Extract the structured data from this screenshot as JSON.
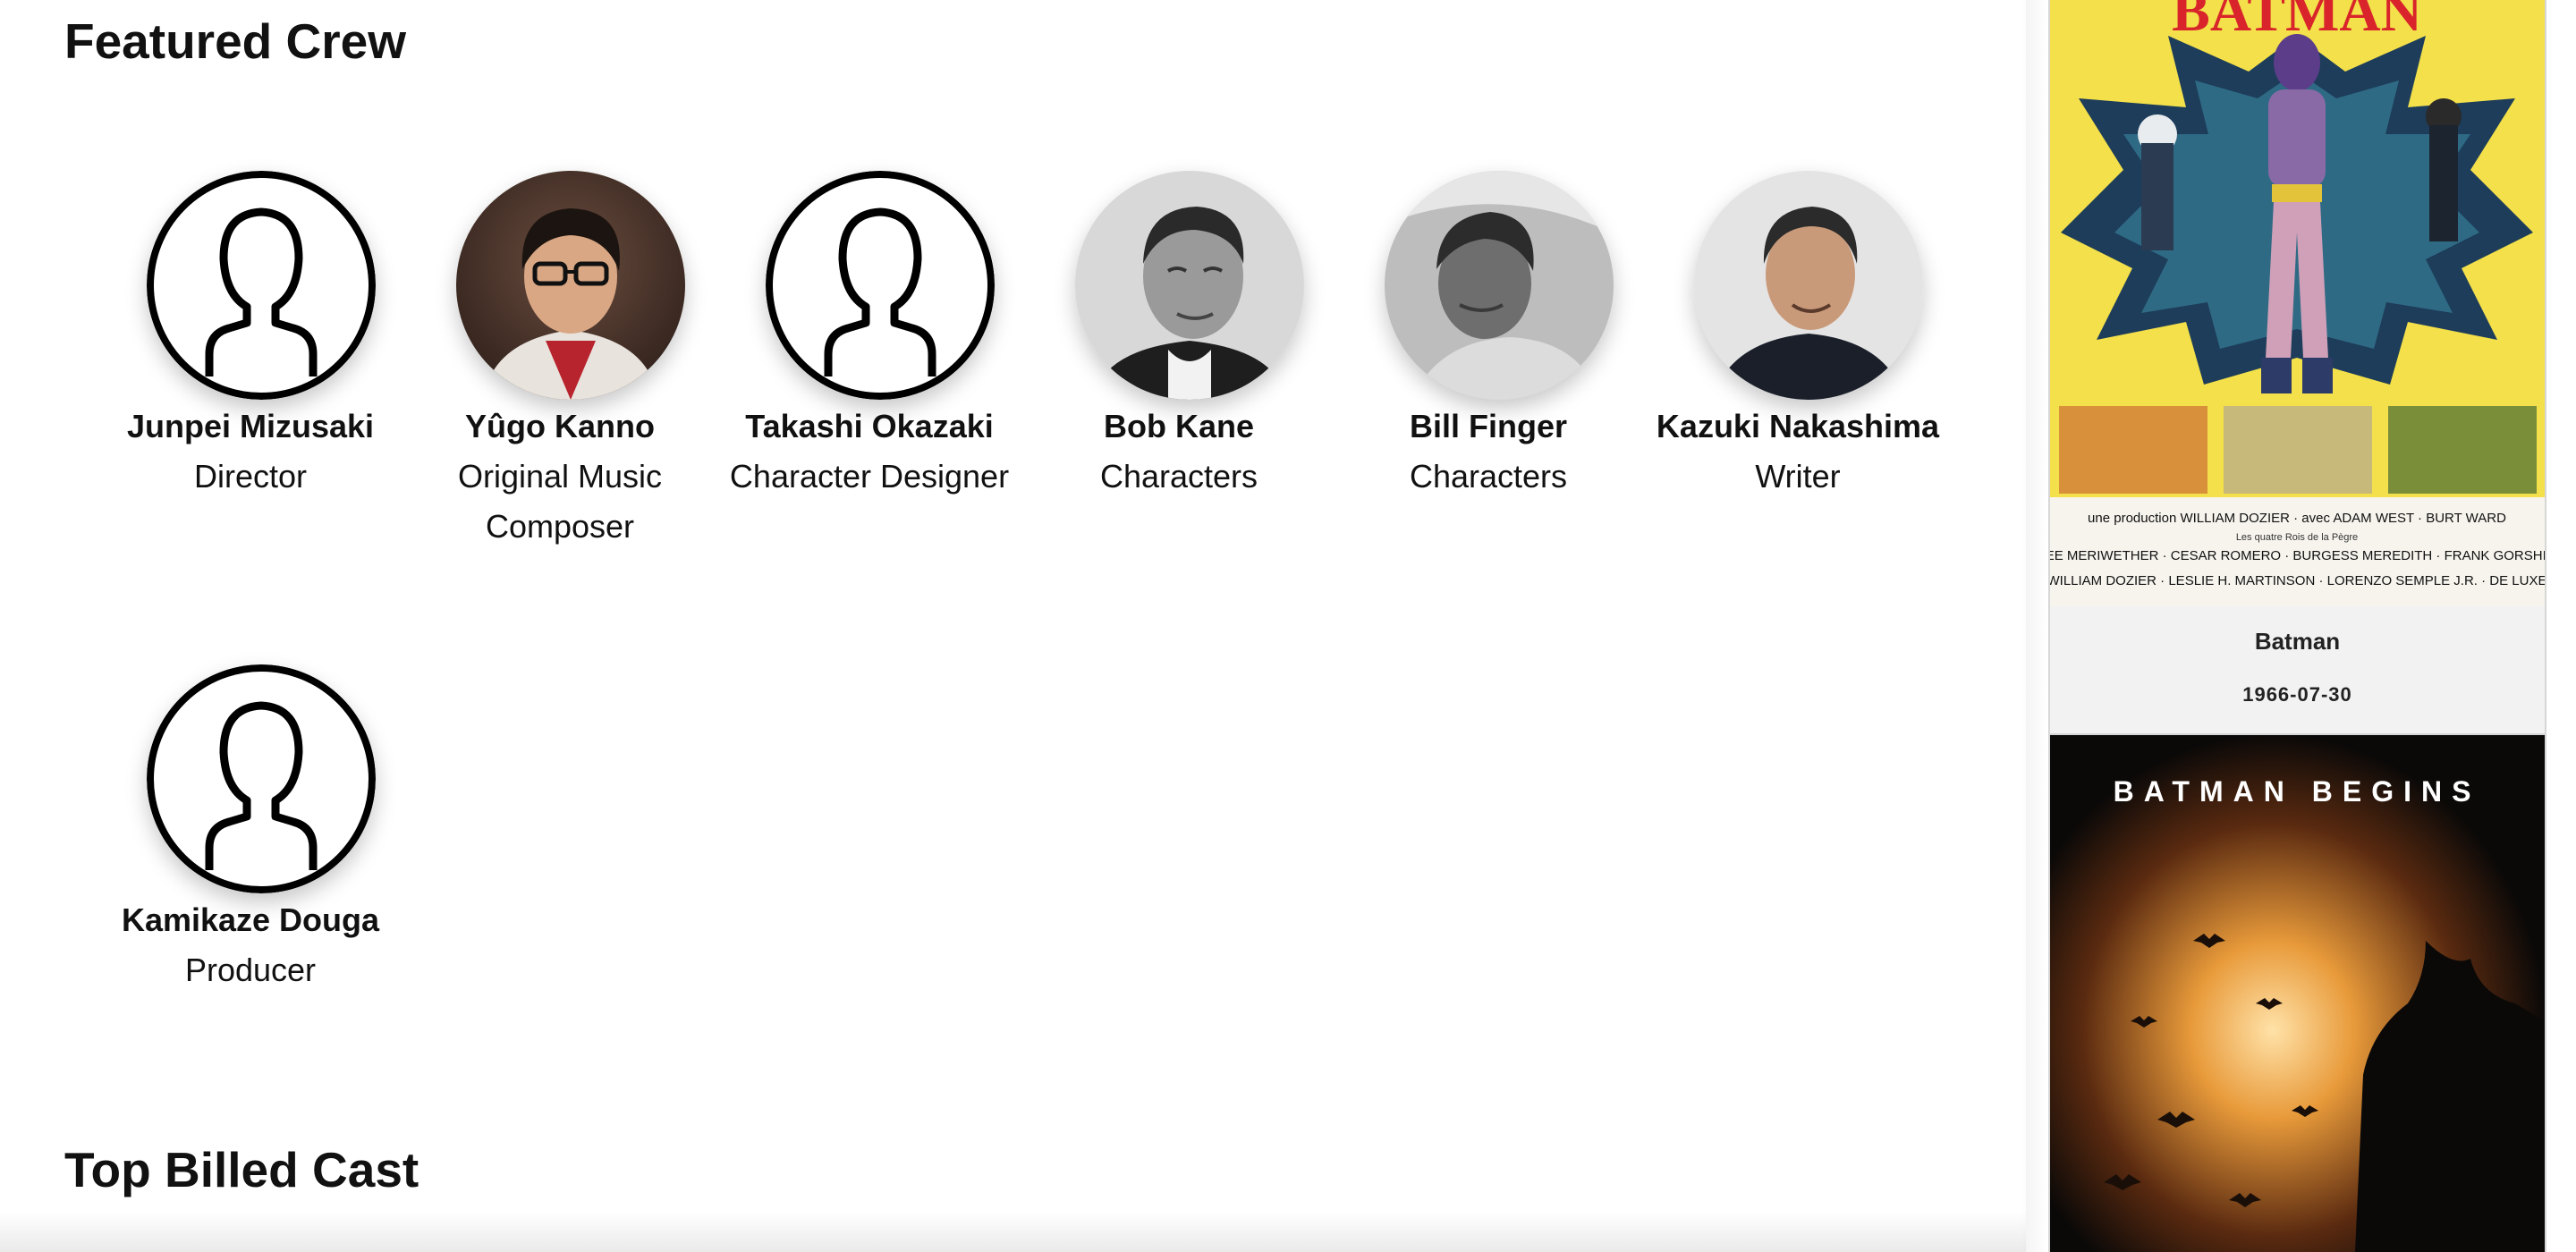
{
  "sections": {
    "featured_crew": "Featured Crew",
    "top_billed_cast": "Top Billed Cast"
  },
  "crew": [
    {
      "name": "Junpei Mizusaki",
      "job": "Director",
      "photo": "placeholder-silhouette-icon"
    },
    {
      "name": "Yûgo Kanno",
      "job": "Original Music Composer",
      "photo": "profile-photo"
    },
    {
      "name": "Takashi Okazaki",
      "job": "Character Designer",
      "photo": "placeholder-silhouette-icon"
    },
    {
      "name": "Bob Kane",
      "job": "Characters",
      "photo": "profile-photo"
    },
    {
      "name": "Bill Finger",
      "job": "Characters",
      "photo": "profile-photo"
    },
    {
      "name": "Kazuki Nakashima",
      "job": "Writer",
      "photo": "profile-photo"
    },
    {
      "name": "Kamikaze Douga",
      "job": "Producer",
      "photo": "placeholder-silhouette-icon"
    }
  ],
  "recommendations": [
    {
      "title": "Batman",
      "date": "1966-07-30",
      "poster": {
        "headline": "BATMAN",
        "credit_line_1": "une production WILLIAM DOZIER · avec ADAM WEST · BURT WARD",
        "credit_line_2": "Les quatre Rois de la Pègre",
        "credit_line_3": "LEE MERIWETHER · CESAR ROMERO · BURGESS MEREDITH · FRANK GORSHIN",
        "credit_line_4": "WILLIAM DOZIER · LESLIE H. MARTINSON · LORENZO SEMPLE J.R. · DE LUXE"
      }
    },
    {
      "title": "Batman Begins",
      "poster": {
        "headline": "BATMAN BEGINS"
      }
    }
  ],
  "colors": {
    "text": "#111111",
    "card_bg": "#f2f2f2",
    "poster1_bg": "#f3e04a",
    "poster2_glow": "#e89a3a"
  }
}
